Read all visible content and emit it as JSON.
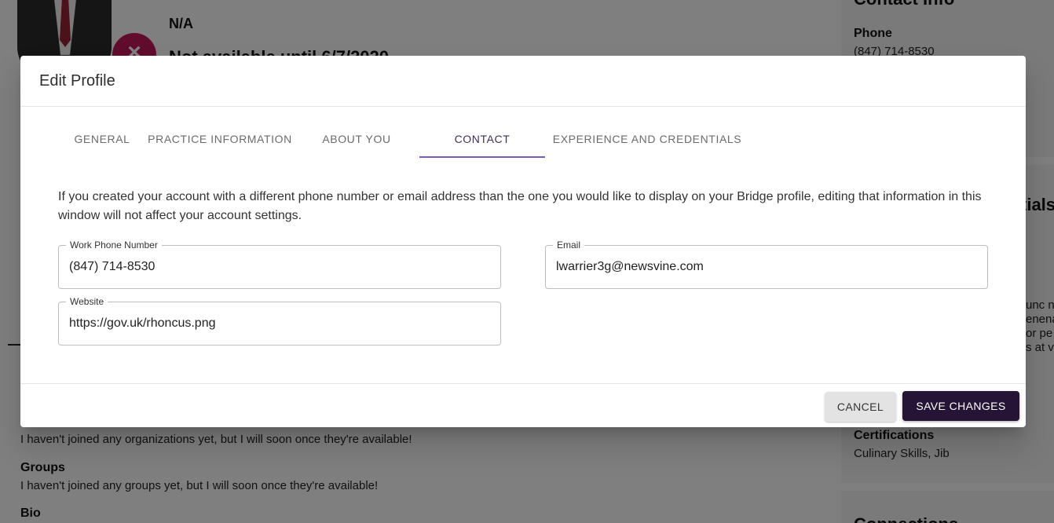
{
  "background": {
    "profile_name": "N/A",
    "availability": "Not available until 6/7/2020",
    "contact_info_title": "Contact Info",
    "phone_label": "Phone",
    "phone_value": "(847) 714-8530",
    "credentials_title_fragment": "tials",
    "right_fragments": [
      "unc n",
      "enena",
      "or pe",
      "s at v"
    ],
    "certifications_label": "Certifications",
    "certifications_value": "Culinary Skills, Jib",
    "connections_title_fragment": "Connections",
    "organizations_text": "I haven't joined any organizations yet, but I will soon once they're available!",
    "groups_label": "Groups",
    "groups_text": "I haven't joined any groups yet, but I will soon once they're available!",
    "bio_label": "Bio"
  },
  "dialog": {
    "title": "Edit Profile",
    "tabs": [
      {
        "label": "GENERAL"
      },
      {
        "label": "PRACTICE INFORMATION"
      },
      {
        "label": "ABOUT YOU"
      },
      {
        "label": "CONTACT",
        "active": true
      },
      {
        "label": "EXPERIENCE AND CREDENTIALS"
      }
    ],
    "info_text": "If you created your account with a different phone number or email address than the one you would like to display on your Bridge profile, editing that information in this window will not affect your account settings.",
    "fields": {
      "work_phone": {
        "label": "Work Phone Number",
        "value": "(847) 714-8530"
      },
      "email": {
        "label": "Email",
        "value": "lwarrier3g@newsvine.com"
      },
      "website": {
        "label": "Website",
        "value": "https://gov.uk/rhoncus.png"
      }
    },
    "buttons": {
      "cancel": "CANCEL",
      "save": "SAVE CHANGES"
    }
  },
  "colors": {
    "tab_indicator": "#7b5cc4",
    "save_button_bg": "#251436",
    "status_badge": "#c2185b",
    "scrim": "rgba(0,0,0,0.5)"
  }
}
